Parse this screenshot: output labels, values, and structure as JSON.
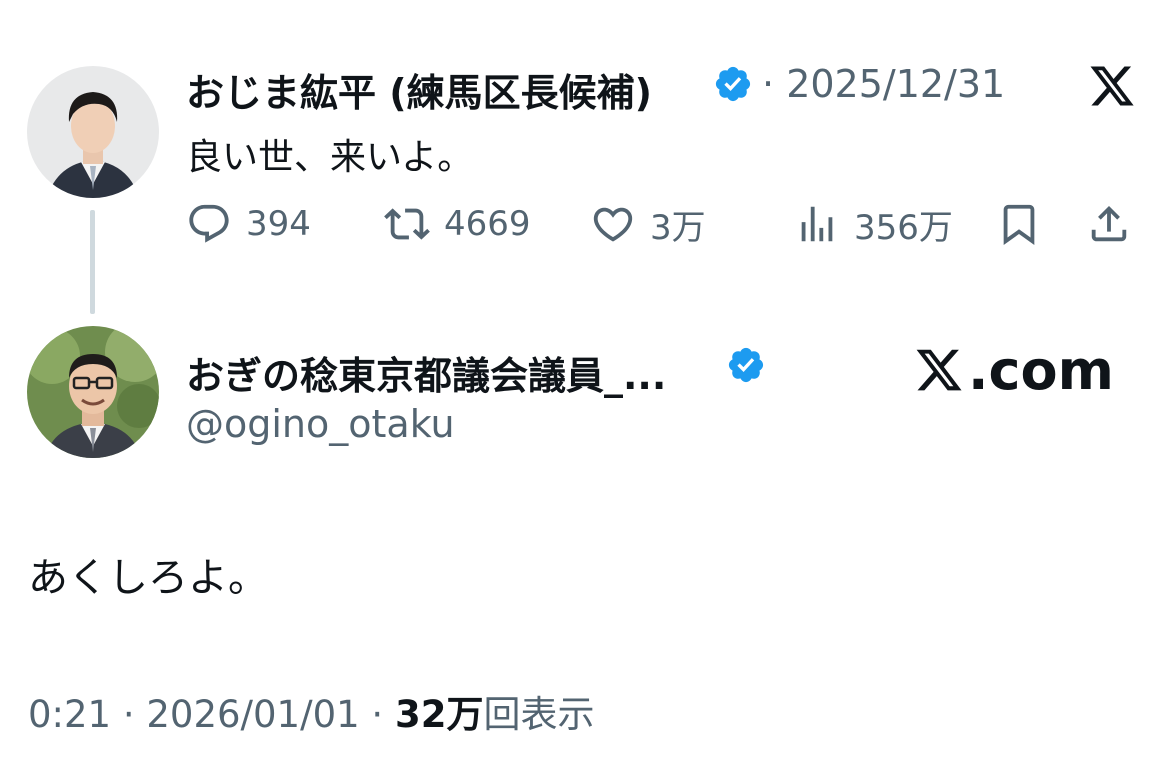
{
  "quoted_tweet": {
    "author_name": "おじま紘平 (練馬区長候補)",
    "separator": "·",
    "date": "2025/12/31",
    "text": "良い世、来いよ。",
    "actions": {
      "reply_count": "394",
      "retweet_count": "4669",
      "like_count": "3万",
      "views_count": "356万"
    }
  },
  "main_tweet": {
    "author_name": "おぎの稔東京都議会議員_...",
    "handle": "@ogino_otaku",
    "text": "あくしろよ。",
    "time": "0:21",
    "date": "2026/01/01",
    "separator": "·",
    "views_number": "32万",
    "views_label": "回表示"
  },
  "branding": {
    "x_com_label": ".com"
  },
  "colors": {
    "verified_blue": "#1d9bf0",
    "text_primary": "#0f1419",
    "text_secondary": "#536471",
    "thread_line": "#cfd9de"
  },
  "icons": {
    "reply": "reply-icon",
    "retweet": "retweet-icon",
    "like": "heart-icon",
    "views": "views-icon",
    "bookmark": "bookmark-icon",
    "share": "share-icon",
    "verified": "verified-badge-icon",
    "x_logo": "x-logo-icon"
  }
}
